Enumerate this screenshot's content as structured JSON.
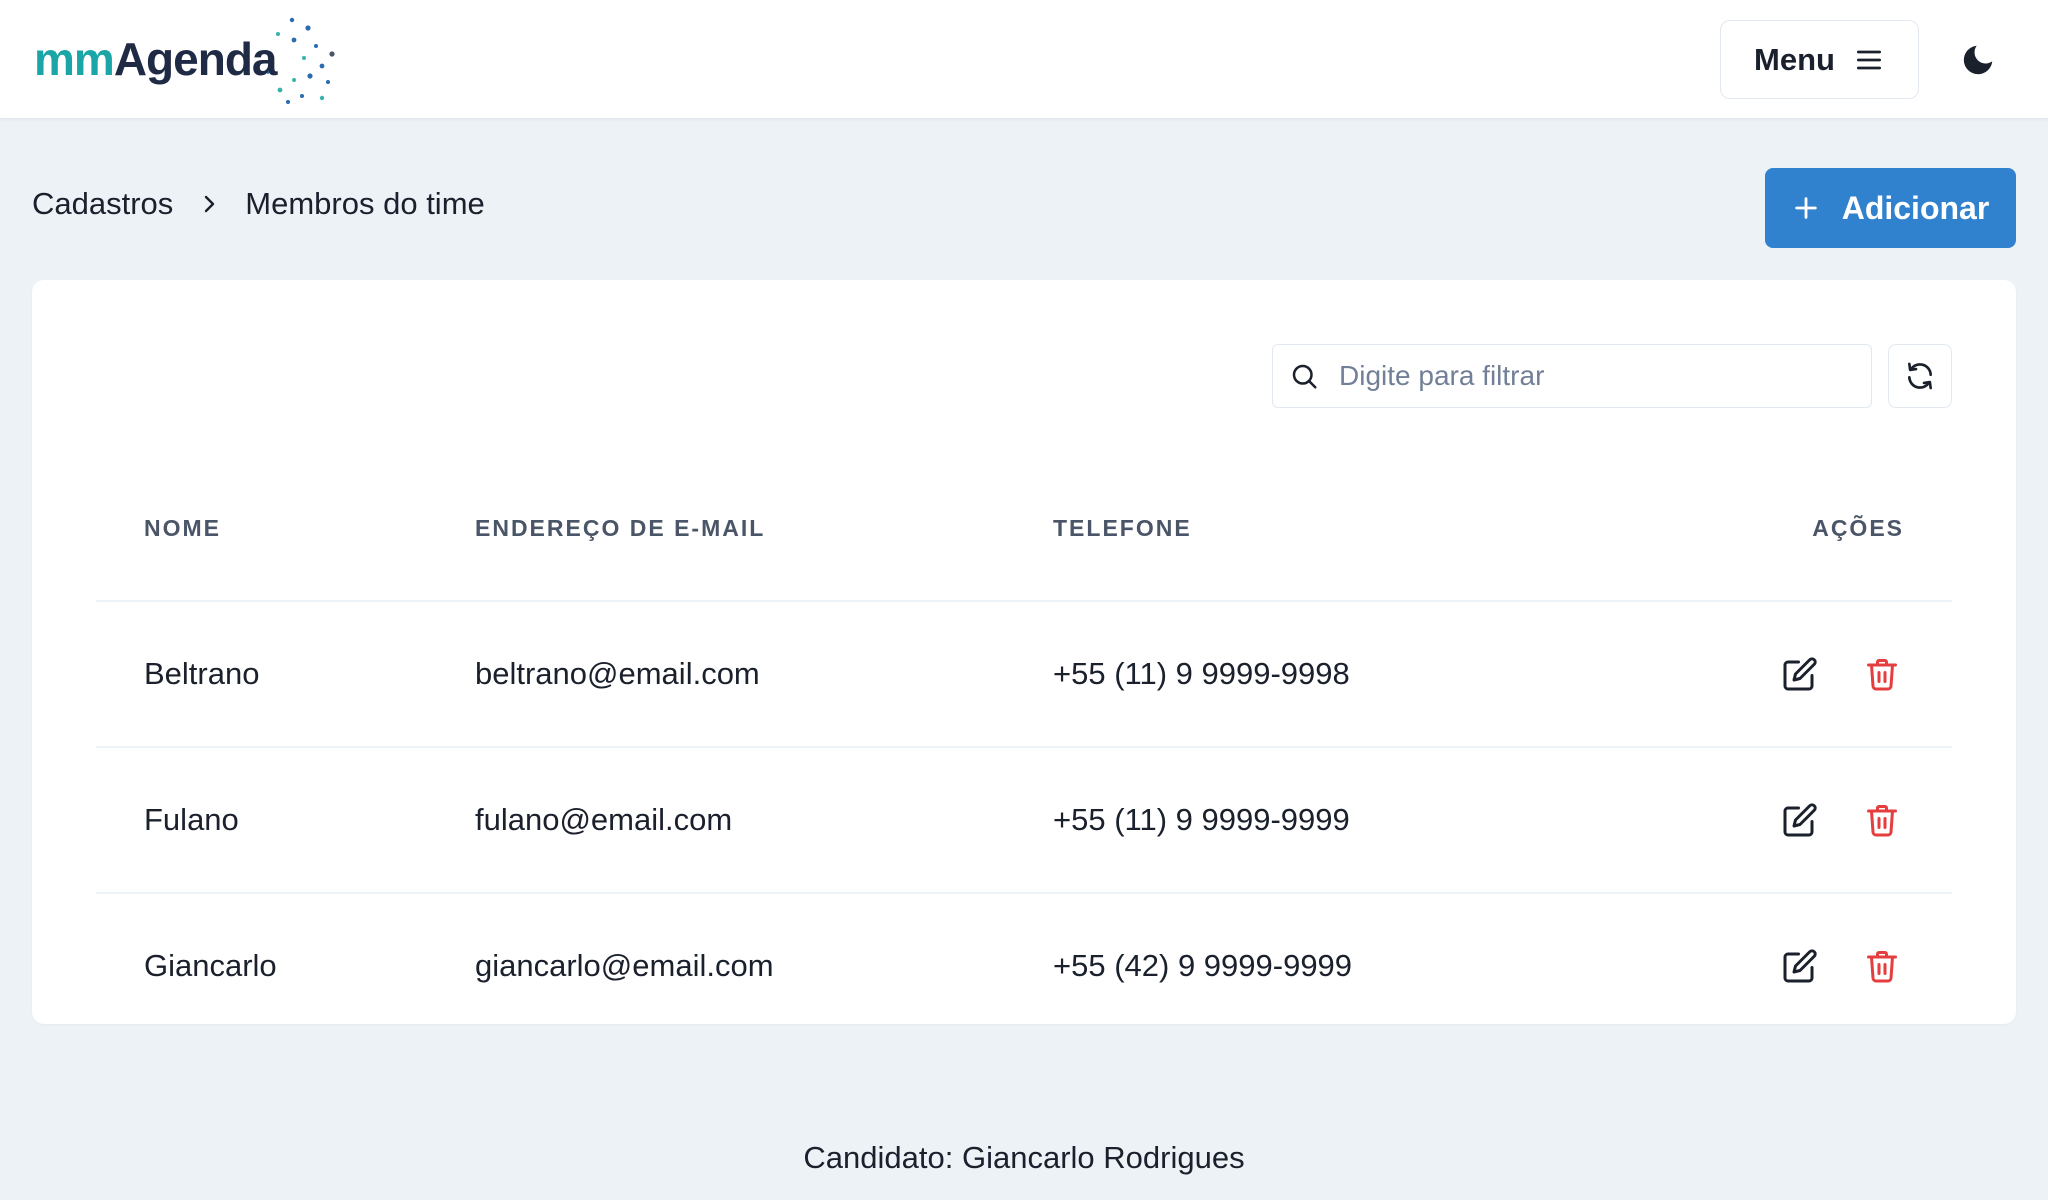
{
  "header": {
    "logo": {
      "part1": "mm",
      "part2": "Agenda"
    },
    "menu_label": "Menu"
  },
  "icons": {
    "menu": "hamburger-icon",
    "theme": "moon-icon",
    "breadcrumb_sep": "chevron-right-icon",
    "add": "plus-icon",
    "search": "search-icon",
    "refresh": "refresh-icon",
    "edit": "edit-icon",
    "delete": "trash-icon"
  },
  "colors": {
    "accent": "#3182ce",
    "danger": "#e53e3e",
    "background": "#edf2f7",
    "logo_teal": "#1aa6a6",
    "logo_dark": "#1f2a44"
  },
  "breadcrumb": {
    "items": [
      "Cadastros",
      "Membros do time"
    ]
  },
  "actions": {
    "add_label": "Adicionar"
  },
  "search": {
    "placeholder": "Digite para filtrar",
    "value": ""
  },
  "table": {
    "columns": [
      "NOME",
      "ENDEREÇO DE E-MAIL",
      "TELEFONE",
      "AÇÕES"
    ],
    "rows": [
      {
        "name": "Beltrano",
        "email": "beltrano@email.com",
        "phone": "+55 (11) 9 9999-9998"
      },
      {
        "name": "Fulano",
        "email": "fulano@email.com",
        "phone": "+55 (11) 9 9999-9999"
      },
      {
        "name": "Giancarlo",
        "email": "giancarlo@email.com",
        "phone": "+55 (42) 9 9999-9999"
      }
    ]
  },
  "footer": {
    "text": "Candidato: Giancarlo Rodrigues"
  }
}
